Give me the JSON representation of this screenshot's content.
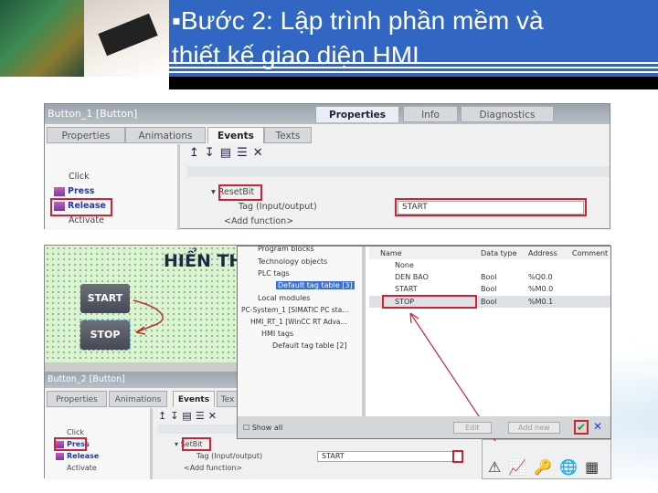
{
  "slide": {
    "title_line1": "▪Bước 2: Lập trình phần mềm và",
    "title_line2": "thiết kế giao diện HMI",
    "accent": "#3166c2"
  },
  "top_panel": {
    "title": "Button_1 [Button]",
    "header_tabs": [
      "Properties",
      "Info",
      "Diagnostics"
    ],
    "tabs": [
      "Properties",
      "Animations",
      "Events",
      "Texts"
    ],
    "active_tab": "Events",
    "events": [
      "Click",
      "Press",
      "Release",
      "Activate"
    ],
    "selected_event": "Release",
    "function": "ResetBit",
    "param_label": "Tag (Input/output)",
    "param_value": "START",
    "add_function": "<Add function>"
  },
  "hmi_screen": {
    "heading": "HIỂN TH",
    "buttons": [
      "START",
      "STOP"
    ]
  },
  "tree": {
    "items": [
      "Program blocks",
      "Technology objects",
      "PLC tags",
      "Default tag table [3]",
      "Local modules",
      "PC-System_1 [SIMATIC PC sta...",
      "HMI_RT_1 [WinCC RT Adva...",
      "HMI tags",
      "Default tag table [2]"
    ]
  },
  "tag_table": {
    "columns": [
      "Name",
      "Data type",
      "Address",
      "Comment"
    ],
    "rows": [
      {
        "name": "None",
        "type": "",
        "address": ""
      },
      {
        "name": "DEN BAO",
        "type": "Bool",
        "address": "%Q0.0"
      },
      {
        "name": "START",
        "type": "Bool",
        "address": "%M0.0"
      },
      {
        "name": "STOP",
        "type": "Bool",
        "address": "%M0.1"
      }
    ],
    "show_all": "Show all",
    "edit": "Edit",
    "add_new": "Add new"
  },
  "bottom_panel": {
    "title": "Button_2 [Button]",
    "tabs": [
      "Properties",
      "Animations",
      "Events",
      "Tex"
    ],
    "events": [
      "Click",
      "Press",
      "Release",
      "Activate"
    ],
    "selected_event": "Press",
    "function": "SetBit",
    "param_label": "Tag (Input/output)",
    "param_value": "START",
    "add_function": "<Add function>"
  }
}
